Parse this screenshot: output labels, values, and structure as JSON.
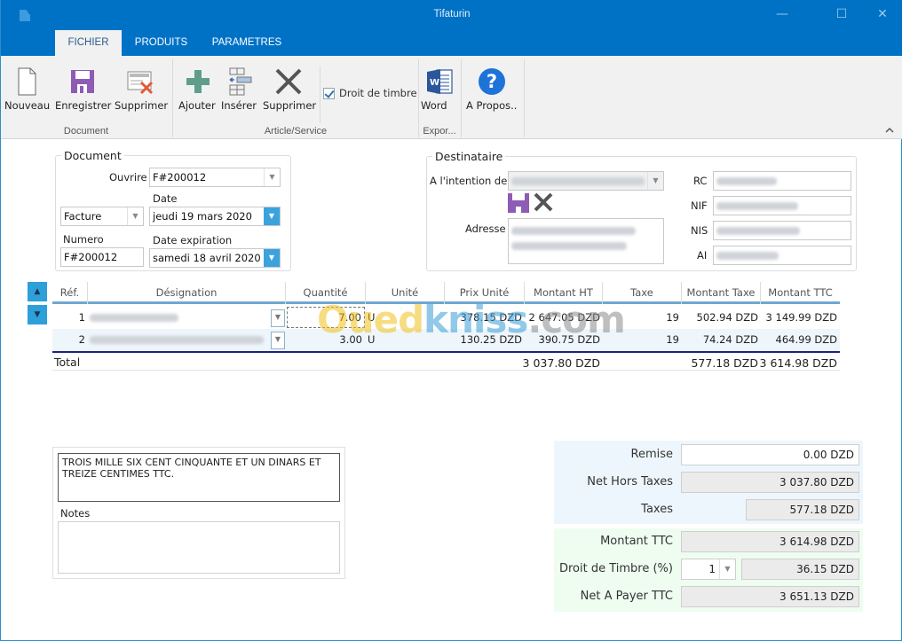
{
  "window": {
    "title": "Tifaturin",
    "controls": {
      "minimize": "—",
      "maximize": "☐",
      "close": "✕"
    }
  },
  "ribbon": {
    "tabs": [
      {
        "label": "FICHIER",
        "active": true
      },
      {
        "label": "PRODUITS",
        "active": false
      },
      {
        "label": "PARAMETRES",
        "active": false
      }
    ],
    "groups": {
      "document": {
        "label": "Document",
        "buttons": {
          "new": "Nouveau",
          "save": "Enregistrer",
          "delete": "Supprimer"
        }
      },
      "article": {
        "label": "Article/Service",
        "buttons": {
          "add": "Ajouter",
          "insert": "Insérer",
          "delete": "Supprimer"
        },
        "stamp_checkbox": {
          "label": "Droit de timbre",
          "checked": true
        }
      },
      "export": {
        "label": "Expor...",
        "buttons": {
          "word": "Word"
        }
      },
      "about": {
        "buttons": {
          "about": "A Propos.."
        }
      }
    },
    "icons": {
      "new": "new-document-icon",
      "save": "floppy-disk-icon",
      "delete_doc": "delete-document-icon",
      "add": "plus-icon",
      "insert": "insert-row-icon",
      "delete_item": "x-icon",
      "word": "word-icon",
      "about": "help-icon",
      "collapse": "chevron-up-icon"
    }
  },
  "document_group": {
    "legend": "Document",
    "open_label": "Ouvrire",
    "open_value": "F#200012",
    "type_value": "Facture",
    "date_label": "Date",
    "date_value": "jeudi 19 mars 2020",
    "number_label": "Numero",
    "number_value": "F#200012",
    "expiry_label": "Date expiration",
    "expiry_value": "samedi 18 avril 2020"
  },
  "recipient_group": {
    "legend": "Destinataire",
    "for_label": "A l'intention de",
    "address_label": "Adresse",
    "rc_label": "RC",
    "nif_label": "NIF",
    "nis_label": "NIS",
    "ai_label": "AI"
  },
  "grid": {
    "columns": [
      "Réf.",
      "Désignation",
      "Quantité",
      "Unité",
      "Prix Unité",
      "Montant HT",
      "Taxe",
      "Montant Taxe",
      "Montant TTC"
    ],
    "rows": [
      {
        "ref": "1",
        "designation": "",
        "quantity": "7.00",
        "unit": "U",
        "unit_price": "378.15 DZD",
        "amount_ht": "2 647.05 DZD",
        "tax": "19",
        "tax_amount": "502.94 DZD",
        "amount_ttc": "3 149.99 DZD"
      },
      {
        "ref": "2",
        "designation": "",
        "quantity": "3.00",
        "unit": "U",
        "unit_price": "130.25 DZD",
        "amount_ht": "390.75 DZD",
        "tax": "19",
        "tax_amount": "74.24 DZD",
        "amount_ttc": "464.99 DZD"
      }
    ],
    "total": {
      "label": "Total",
      "amount_ht": "3 037.80 DZD",
      "tax_amount": "577.18 DZD",
      "amount_ttc": "3 614.98 DZD"
    },
    "nav": {
      "up": "▲",
      "down": "▼"
    }
  },
  "amount_words": "TROIS MILLE SIX CENT CINQUANTE ET UN DINARS ET TREIZE CENTIMES TTC.",
  "notes": {
    "label": "Notes",
    "value": ""
  },
  "summary": {
    "discount_label": "Remise",
    "discount_value": "0.00 DZD",
    "net_ht_label": "Net Hors Taxes",
    "net_ht_value": "3 037.80 DZD",
    "taxes_label": "Taxes",
    "taxes_value": "577.18 DZD",
    "ttc_label": "Montant TTC",
    "ttc_value": "3 614.98 DZD",
    "stamp_label": "Droit de Timbre (%)",
    "stamp_rate": "1",
    "stamp_value": "36.15 DZD",
    "net_pay_label": "Net A Payer TTC",
    "net_pay_value": "3 651.13 DZD"
  },
  "watermark": {
    "part1": "Oued",
    "part2": "kniss",
    "part3": ".com"
  },
  "colors": {
    "titlebar": "#0072c6",
    "ribbon": "#f1f1f1",
    "accent": "#3aa3dd",
    "save_purple": "#8e5bb5",
    "word_blue": "#2b579a",
    "help_blue": "#1e73d8"
  }
}
